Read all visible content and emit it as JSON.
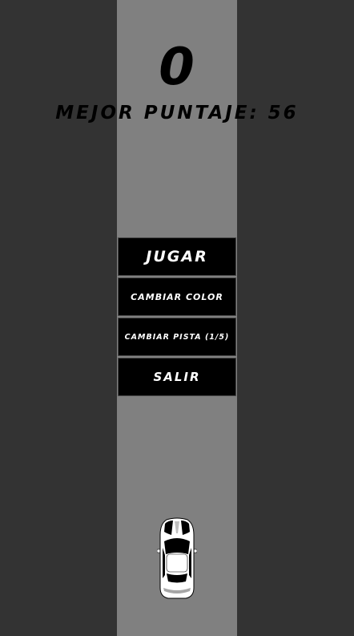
{
  "score": "0",
  "best_score": {
    "label": "MEJOR PUNTAJE: 56"
  },
  "menu": {
    "play": "JUGAR",
    "change_color": "CAMBIAR COLOR",
    "change_track": "CAMBIAR PISTA (1/5)",
    "exit": "SALIR"
  },
  "colors": {
    "background": "#333333",
    "road": "#808080",
    "button": "#000000",
    "button_text": "#ffffff",
    "car": "#ffffff"
  },
  "icons": {
    "car": "car-icon"
  }
}
